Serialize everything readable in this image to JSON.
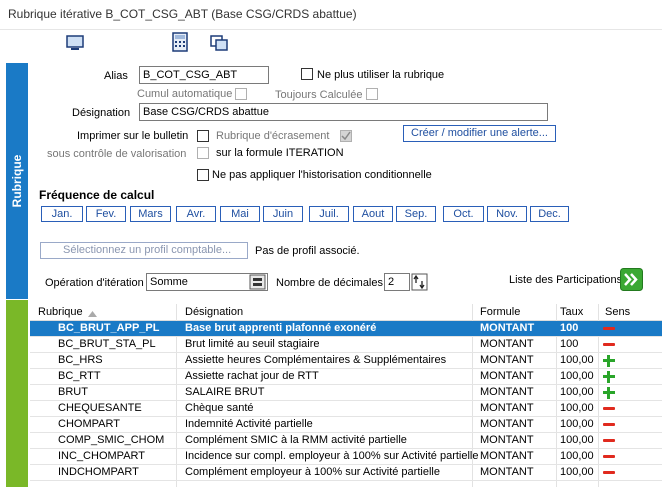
{
  "window": {
    "title": "Rubrique itérative B_COT_CSG_ABT (Base CSG/CRDS abattue)"
  },
  "sidetab": {
    "label": "Rubrique"
  },
  "form": {
    "alias_label": "Alias",
    "alias_value": "B_COT_CSG_ABT",
    "no_use_label": "Ne plus utiliser la rubrique",
    "cumul_label": "Cumul automatique",
    "toujours_label": "Toujours Calculée",
    "designation_label": "Désignation",
    "designation_value": "Base CSG/CRDS abattue",
    "print_label": "Imprimer sur le bulletin",
    "valorisation_label": "sous contrôle de valorisation",
    "ecrasement_label": "Rubrique d'écrasement",
    "formule_iter_label": "sur la formule ITERATION",
    "alerte_button": "Créer / modifier une alerte...",
    "histo_label": "Ne pas appliquer l'historisation conditionnelle",
    "frequence_title": "Fréquence de calcul",
    "months": [
      "Jan.",
      "Fev.",
      "Mars",
      "Avr.",
      "Mai",
      "Juin",
      "Juil.",
      "Aout",
      "Sep.",
      "Oct.",
      "Nov.",
      "Dec."
    ],
    "profil_button": "Sélectionnez un profil comptable...",
    "profil_status": "Pas de profil associé.",
    "operation_label": "Opération d'itération",
    "operation_value": "Somme",
    "decimales_label": "Nombre de décimales",
    "decimales_value": "2",
    "participations_label": "Liste des Participations"
  },
  "table": {
    "headers": {
      "rubrique": "Rubrique",
      "designation": "Désignation",
      "formule": "Formule",
      "taux": "Taux",
      "sens": "Sens"
    },
    "rows": [
      {
        "rubrique": "BC_BRUT_APP_PL",
        "designation": "Base brut apprenti plafonné exonéré",
        "formule": "MONTANT",
        "taux": "100",
        "sens": "minus"
      },
      {
        "rubrique": "BC_BRUT_STA_PL",
        "designation": "Brut limité au seuil stagiaire",
        "formule": "MONTANT",
        "taux": "100",
        "sens": "minus"
      },
      {
        "rubrique": "BC_HRS",
        "designation": "Assiette heures Complémentaires & Supplémentaires",
        "formule": "MONTANT",
        "taux": "100,00",
        "sens": "plus"
      },
      {
        "rubrique": "BC_RTT",
        "designation": "Assiette rachat jour de RTT",
        "formule": "MONTANT",
        "taux": "100,00",
        "sens": "plus"
      },
      {
        "rubrique": "BRUT",
        "designation": "SALAIRE BRUT",
        "formule": "MONTANT",
        "taux": "100,00",
        "sens": "plus"
      },
      {
        "rubrique": "CHEQUESANTE",
        "designation": "Chèque santé",
        "formule": "MONTANT",
        "taux": "100,00",
        "sens": "minus"
      },
      {
        "rubrique": "CHOMPART",
        "designation": "Indemnité Activité partielle",
        "formule": "MONTANT",
        "taux": "100,00",
        "sens": "minus"
      },
      {
        "rubrique": "COMP_SMIC_CHOM",
        "designation": "Complément SMIC à la RMM activité partielle",
        "formule": "MONTANT",
        "taux": "100,00",
        "sens": "minus"
      },
      {
        "rubrique": "INC_CHOMPART",
        "designation": "Incidence sur compl. employeur à 100% sur Activité partielle",
        "formule": "MONTANT",
        "taux": "100,00",
        "sens": "minus"
      },
      {
        "rubrique": "INDCHOMPART",
        "designation": "Complément employeur à 100% sur Activité partielle",
        "formule": "MONTANT",
        "taux": "100,00",
        "sens": "minus"
      }
    ]
  },
  "colors": {
    "accent_blue": "#1a7ac6",
    "accent_green": "#7ab828",
    "minus_red": "#e02a1e",
    "plus_green": "#2aa52a"
  }
}
